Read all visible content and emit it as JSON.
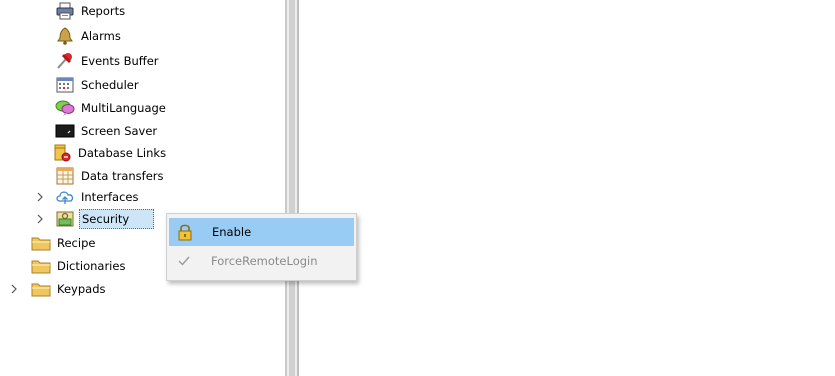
{
  "tree": {
    "items": [
      {
        "label": "Reports",
        "icon": "printer-icon"
      },
      {
        "label": "Alarms",
        "icon": "bell-icon"
      },
      {
        "label": "Events Buffer",
        "icon": "pushpin-icon"
      },
      {
        "label": "Scheduler",
        "icon": "calendar-icon"
      },
      {
        "label": "MultiLanguage",
        "icon": "speech-bubble-icon"
      },
      {
        "label": "Screen Saver",
        "icon": "monitor-icon"
      },
      {
        "label": "Database Links",
        "icon": "database-icon"
      },
      {
        "label": "Data transfers",
        "icon": "table-icon"
      },
      {
        "label": "Interfaces",
        "icon": "cloud-icon"
      },
      {
        "label": "Security",
        "icon": "security-icon"
      },
      {
        "label": "Recipe",
        "icon": "folder-icon"
      },
      {
        "label": "Dictionaries",
        "icon": "folder-icon"
      },
      {
        "label": "Keypads",
        "icon": "folder-icon"
      }
    ]
  },
  "context_menu": {
    "items": [
      {
        "label": "Enable",
        "icon": "lock-icon",
        "state": "highlighted"
      },
      {
        "label": "ForceRemoteLogin",
        "icon": "checkmark-icon",
        "state": "disabled"
      }
    ]
  },
  "colors": {
    "selection_bg": "#cde6f7",
    "menu_highlight": "#99ccf5",
    "folder": "#f0c75e"
  }
}
